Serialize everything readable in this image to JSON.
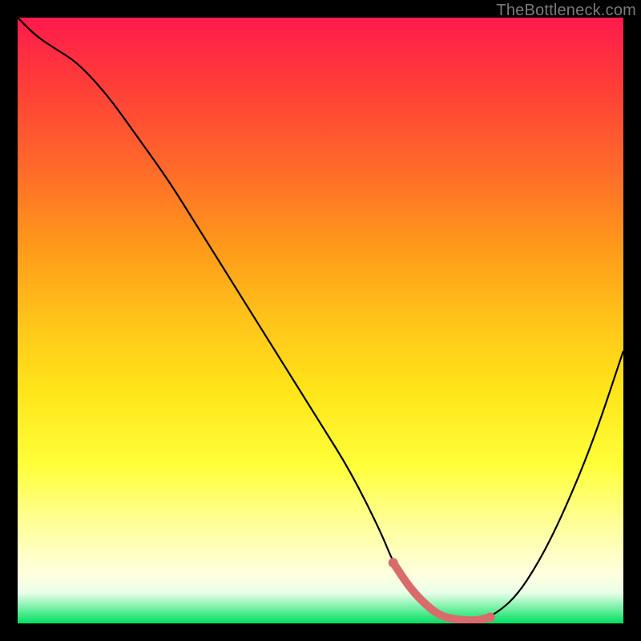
{
  "watermark": "TheBottleneck.com",
  "colors": {
    "highlight": "#d96b6b",
    "curve": "#000000",
    "background": "#000000"
  },
  "chart_data": {
    "type": "line",
    "title": "",
    "xlabel": "",
    "ylabel": "",
    "xlim": [
      0,
      100
    ],
    "ylim": [
      0,
      100
    ],
    "x": [
      0,
      3,
      6,
      10,
      15,
      20,
      25,
      30,
      35,
      40,
      45,
      50,
      55,
      60,
      62,
      65,
      68,
      70,
      72,
      74,
      76,
      78,
      82,
      86,
      90,
      95,
      100
    ],
    "values": [
      100,
      97,
      95,
      92.5,
      87,
      80,
      73,
      65,
      57,
      49,
      41,
      33,
      25,
      15,
      10,
      5.5,
      2.5,
      1.2,
      0.7,
      0.5,
      0.5,
      1,
      4,
      10,
      18,
      30,
      45
    ],
    "highlight_x_range": [
      62,
      78
    ],
    "legend": [],
    "grid": false
  }
}
